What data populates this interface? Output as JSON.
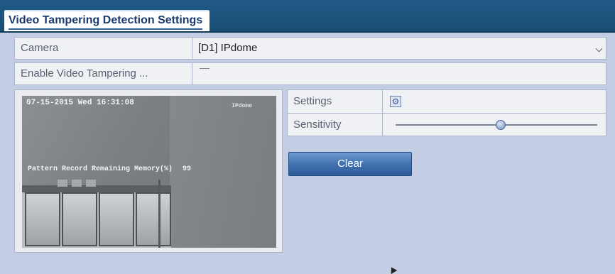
{
  "window": {
    "title": "Video Tampering Detection Settings"
  },
  "form": {
    "camera_label": "Camera",
    "camera_value": "[D1] IPdome",
    "enable_label": "Enable Video Tampering ...",
    "enable_checked": false
  },
  "preview": {
    "osd_datetime": "07-15-2015 Wed 16:31:08",
    "osd_camera_tag": "IPdome",
    "osd_memory_text": "Pattern Record Remaining Memory(%)",
    "osd_memory_value": "99"
  },
  "settings": {
    "settings_label": "Settings",
    "settings_icon": "gear-icon",
    "sensitivity_label": "Sensitivity",
    "sensitivity_level": 0.52
  },
  "buttons": {
    "clear_label": "Clear"
  },
  "colors": {
    "title_bar": "#1f5a85",
    "background": "#c3cee4",
    "button": "#3f6fae"
  }
}
